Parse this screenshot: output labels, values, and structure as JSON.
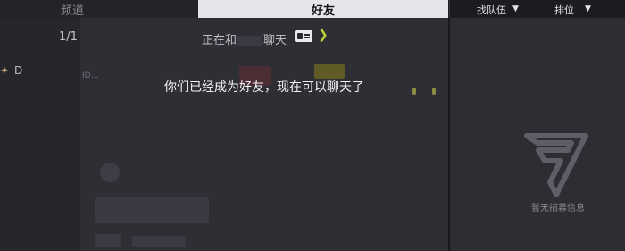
{
  "tabs": {
    "channel": "频道",
    "friends": "好友",
    "find_team": "找队伍",
    "rank": "排位"
  },
  "chat": {
    "page_count": "1/1",
    "status_prefix": "正在和",
    "status_suffix": "聊天",
    "friend_added_toast": "你们已经成为好友，现在可以聊天了",
    "first_row_letter": "D",
    "first_row_name": "ID..."
  },
  "recruit_panel": {
    "empty_text": "暂无招募信息"
  },
  "icons": {
    "card": "id-card-icon",
    "arrow": "chevron-right-icon",
    "logo": "game-logo-icon",
    "chevron": "chevron-down-icon"
  },
  "colors": {
    "active_tab_bg": "#e6e6ea",
    "accent_green": "#b8d43a"
  }
}
